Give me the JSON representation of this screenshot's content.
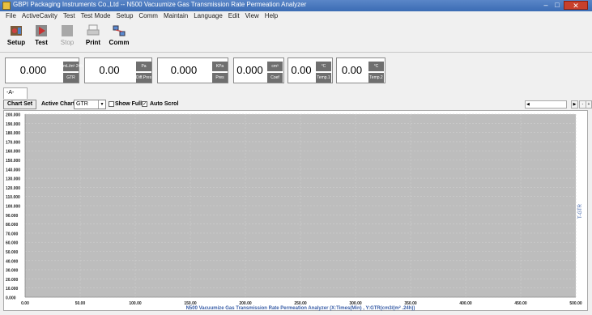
{
  "window": {
    "title": "GBPI Packaging Instruments Co.,Ltd -- N500 Vacuumize Gas Transmission Rate Permeation Analyzer"
  },
  "menu": [
    "File",
    "ActiveCavity",
    "Test",
    "Test Mode",
    "Setup",
    "Comm",
    "Maintain",
    "Language",
    "Edit",
    "View",
    "Help"
  ],
  "toolbar": {
    "setup": "Setup",
    "test": "Test",
    "stop": "Stop",
    "print": "Print",
    "comm": "Comm"
  },
  "readings": [
    {
      "value": "0.000",
      "unit_top": "mL/m²·24h",
      "unit_bottom": "GTR"
    },
    {
      "value": "0.00",
      "unit_top": "Pa",
      "unit_bottom": "Diff.Pres"
    },
    {
      "value": "0.000",
      "unit_top": "KPa",
      "unit_bottom": "Pres"
    },
    {
      "value": "0.000",
      "unit_top": "cm³",
      "unit_bottom": "Coef"
    },
    {
      "value": "0.00",
      "unit_top": "°C",
      "unit_bottom": "Temp.1"
    },
    {
      "value": "0.00",
      "unit_top": "°C",
      "unit_bottom": "Temp.2"
    }
  ],
  "panel_tab": "-A-",
  "chart_controls": {
    "chart_set": "Chart Set",
    "active_chart_label": "Active Chart",
    "active_chart_value": "GTR",
    "show_full": "Show Full",
    "show_full_checked": false,
    "auto_scroll": "Auto Scrol",
    "auto_scroll_checked": true
  },
  "chart_data": {
    "type": "line",
    "title": "N500 Vacuumize Gas Transmission Rate Permeation Analyzer (X:Times(Min) , Y:GTR(cm3/(m² .24h))",
    "right_label": "T-GTR",
    "xlim": [
      0,
      500
    ],
    "ylim": [
      0,
      200
    ],
    "x_ticks": [
      "0.00",
      "50.00",
      "100.00",
      "150.00",
      "200.00",
      "250.00",
      "300.00",
      "350.00",
      "400.00",
      "450.00",
      "500.00"
    ],
    "y_ticks": [
      "200.000",
      "190.000",
      "180.000",
      "170.000",
      "160.000",
      "150.000",
      "140.000",
      "130.000",
      "120.000",
      "110.000",
      "100.000",
      "90.000",
      "80.000",
      "70.000",
      "60.000",
      "50.000",
      "40.000",
      "30.000",
      "20.000",
      "10.000",
      "0.000"
    ],
    "series": [],
    "plot_bg": "#bdbdbd",
    "grid": true
  }
}
